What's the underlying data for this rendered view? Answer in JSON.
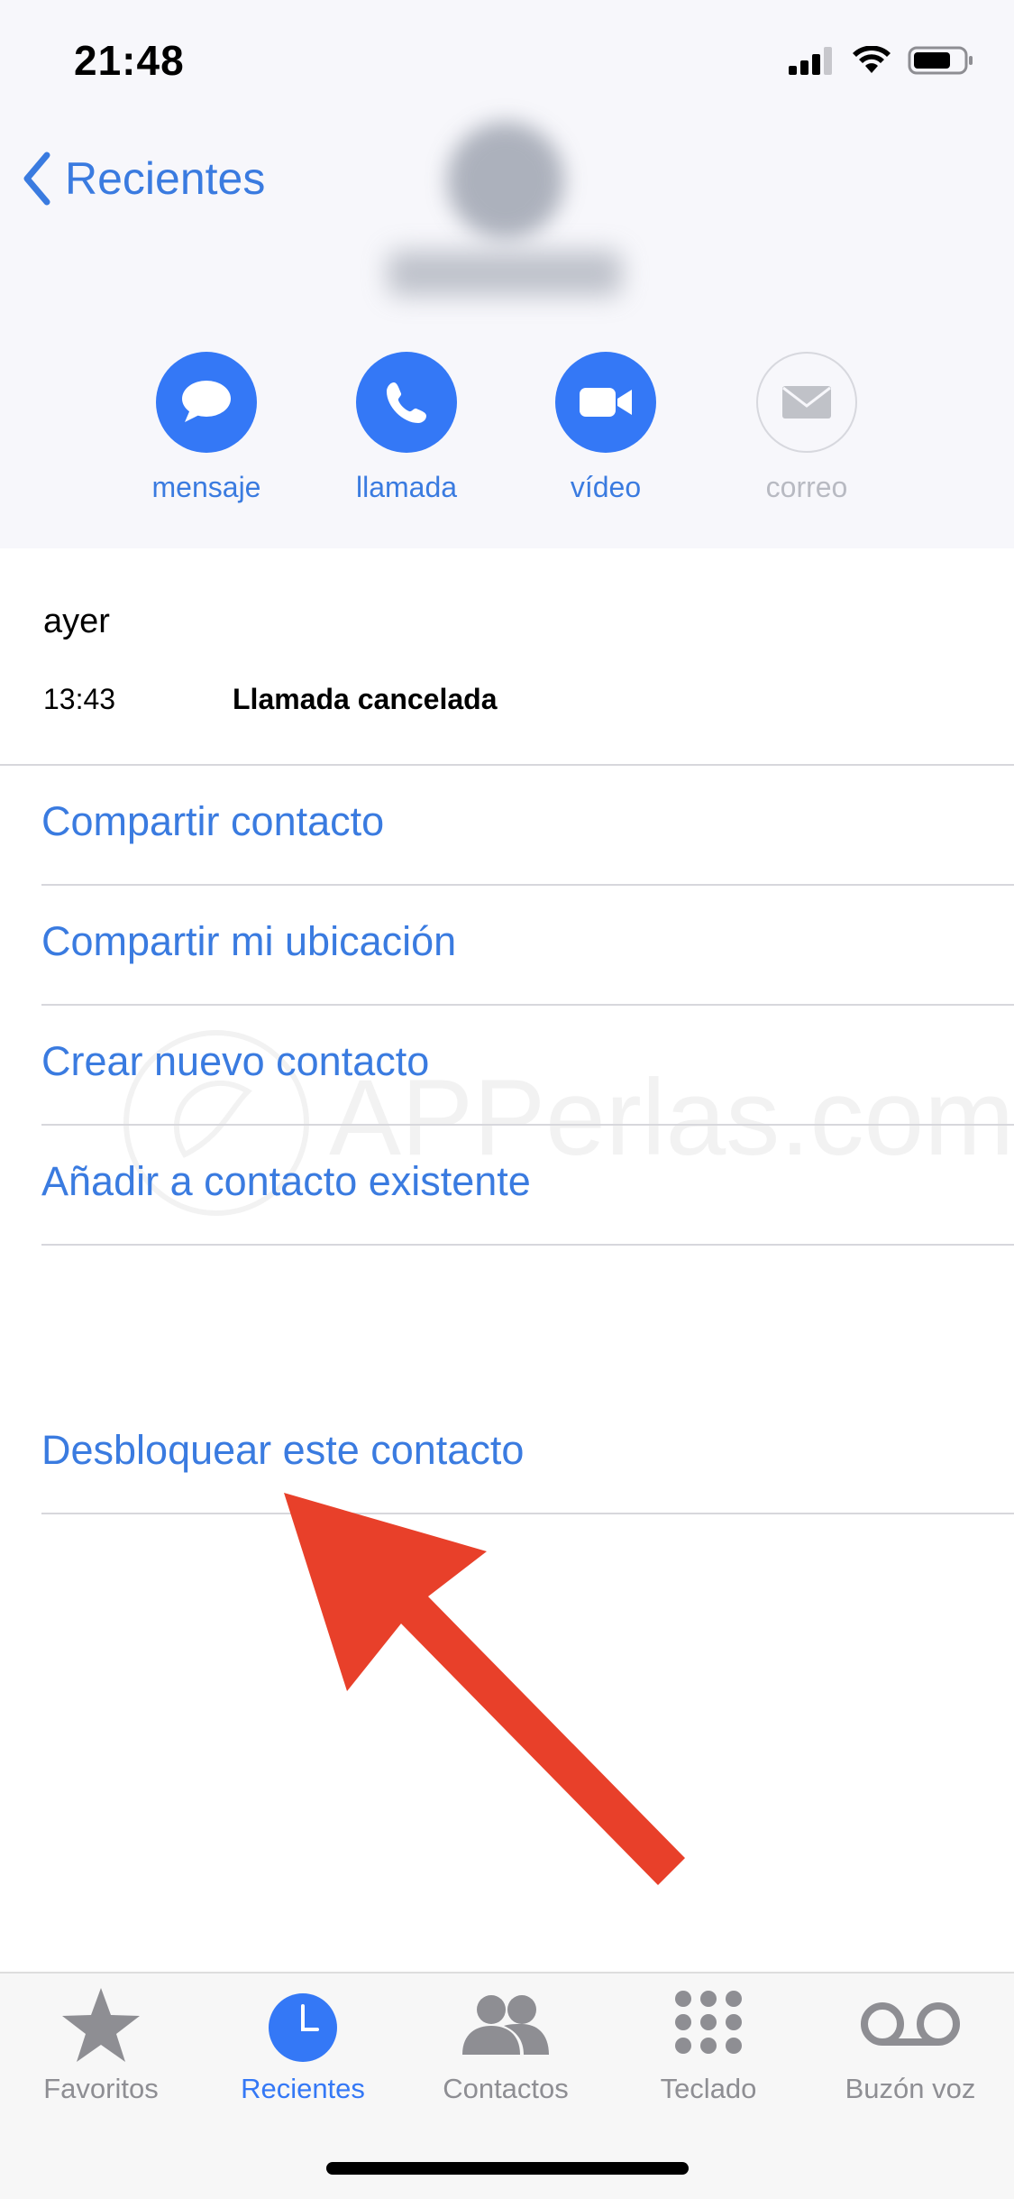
{
  "status_bar": {
    "time": "21:48"
  },
  "nav": {
    "back_label": "Recientes"
  },
  "actions": [
    {
      "label": "mensaje",
      "icon": "message-bubble-icon",
      "enabled": true
    },
    {
      "label": "llamada",
      "icon": "phone-icon",
      "enabled": true
    },
    {
      "label": "vídeo",
      "icon": "video-camera-icon",
      "enabled": true
    },
    {
      "label": "correo",
      "icon": "envelope-icon",
      "enabled": false
    }
  ],
  "call_history": {
    "day": "ayer",
    "time": "13:43",
    "status": "Llamada cancelada"
  },
  "options": [
    "Compartir contacto",
    "Compartir mi ubicación",
    "Crear nuevo contacto",
    "Añadir a contacto existente"
  ],
  "unblock_label": "Desbloquear este contacto",
  "tabs": [
    {
      "label": "Favoritos",
      "icon": "star-icon",
      "active": false
    },
    {
      "label": "Recientes",
      "icon": "clock-icon",
      "active": true
    },
    {
      "label": "Contactos",
      "icon": "contacts-icon",
      "active": false
    },
    {
      "label": "Teclado",
      "icon": "keypad-icon",
      "active": false
    },
    {
      "label": "Buzón voz",
      "icon": "voicemail-icon",
      "active": false
    }
  ],
  "watermark": "APPerlas.com",
  "colors": {
    "accent": "#3478f6",
    "link": "#3a7be0",
    "arrow": "#e8402a",
    "inactive": "#8e8e93"
  }
}
